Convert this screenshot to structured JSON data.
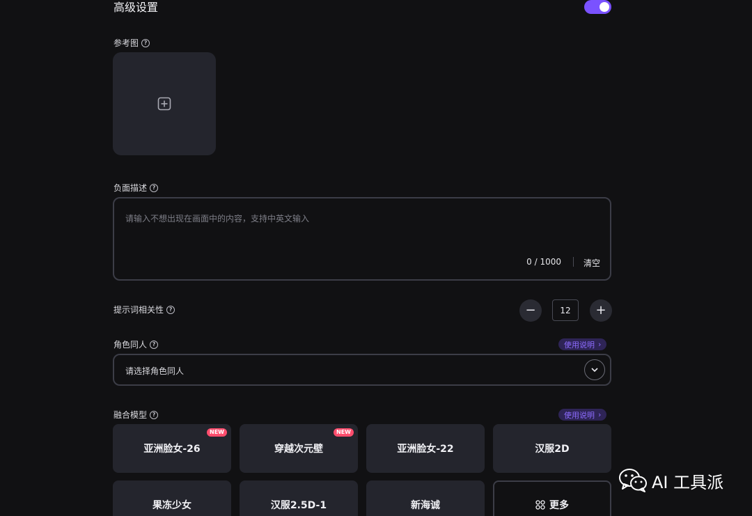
{
  "header": {
    "title": "高级设置",
    "advanced_enabled": true
  },
  "reference_image": {
    "label": "参考图"
  },
  "negative_prompt": {
    "label": "负面描述",
    "placeholder": "请输入不想出现在画面中的内容，支持中英文输入",
    "count": "0 / 1000",
    "clear_label": "清空"
  },
  "prompt_relevance": {
    "label": "提示词相关性",
    "value": "12",
    "minus": "−",
    "plus": "+"
  },
  "character": {
    "label": "角色同人",
    "help_link": "使用说明",
    "select_value": "请选择角色同人"
  },
  "fusion_model": {
    "label": "融合模型",
    "help_link": "使用说明",
    "items": [
      {
        "name": "亚洲脸女-26",
        "badge": "NEW"
      },
      {
        "name": "穿越次元壁",
        "badge": "NEW"
      },
      {
        "name": "亚洲脸女-22",
        "badge": ""
      },
      {
        "name": "汉服2D",
        "badge": ""
      },
      {
        "name": "果冻少女",
        "badge": ""
      },
      {
        "name": "汉服2.5D-1",
        "badge": ""
      },
      {
        "name": "新海诚",
        "badge": ""
      }
    ],
    "more_label": "更多"
  },
  "watermark": {
    "text": "AI 工具派"
  },
  "colors": {
    "accent": "#7a52ff",
    "badge": "#ff4d6d",
    "panel": "#24252d",
    "background": "#111113"
  }
}
